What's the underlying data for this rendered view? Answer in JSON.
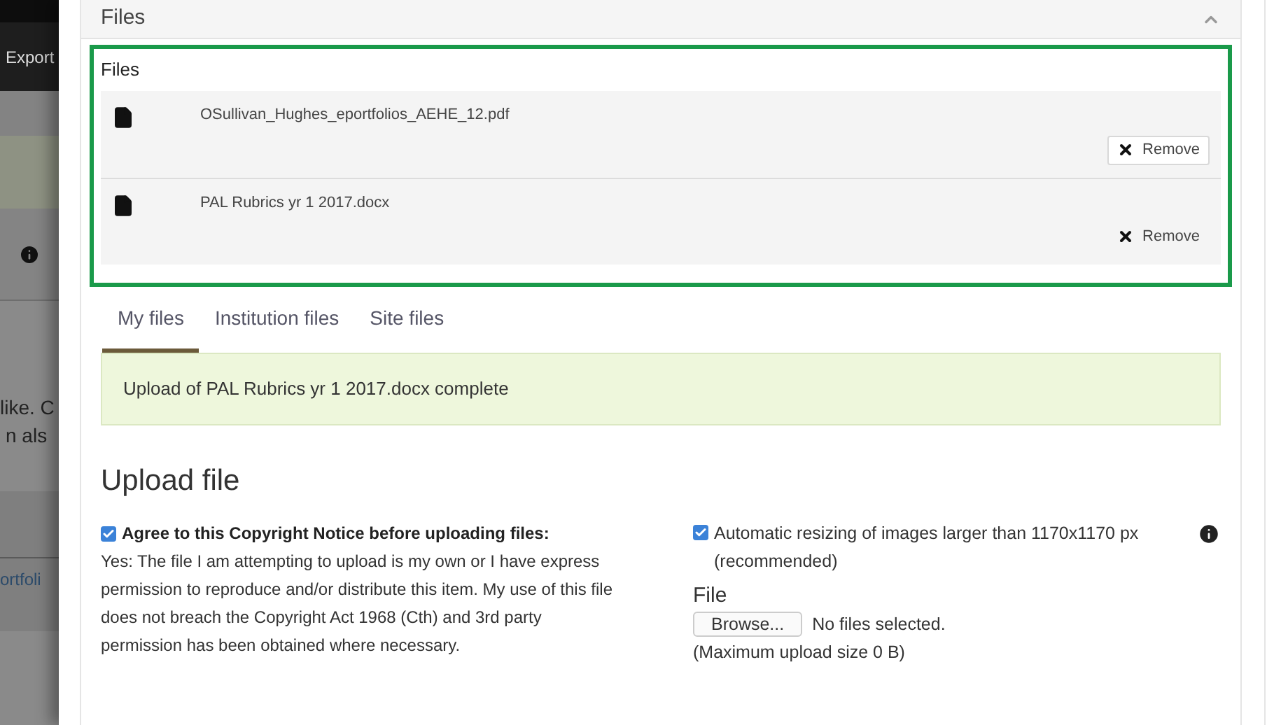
{
  "background": {
    "nav_button": "Export",
    "texts": [
      "like. C",
      "n als",
      "ortfoli"
    ]
  },
  "panel": {
    "title": "Files",
    "expanded": true
  },
  "selected_files": {
    "title": "Files",
    "files": [
      {
        "name": "OSullivan_Hughes_eportfolios_AEHE_12.pdf",
        "remove": "Remove",
        "focused": true
      },
      {
        "name": "PAL Rubrics yr 1 2017.docx",
        "remove": "Remove",
        "focused": false
      }
    ]
  },
  "tabs": [
    {
      "label": "My files",
      "selected": true
    },
    {
      "label": "Institution files",
      "selected": false
    },
    {
      "label": "Site files",
      "selected": false
    }
  ],
  "alert": "Upload of PAL Rubrics yr 1 2017.docx complete",
  "upload": {
    "heading": "Upload file",
    "copyright": {
      "checked": true,
      "label": "Agree to this Copyright Notice before uploading files:",
      "text": "Yes: The file I am attempting to upload is my own or I have express permission to reproduce and/or distribute this item. My use of this file does not breach the Copyright Act 1968 (Cth) and 3rd party permission has been obtained where necessary."
    },
    "resize": {
      "checked": true,
      "label": "Automatic resizing of images larger than 1170x1170 px (recommended)"
    },
    "file": {
      "label": "File",
      "button": "Browse...",
      "status": "No files selected.",
      "limit": "(Maximum upload size 0 B)"
    }
  }
}
